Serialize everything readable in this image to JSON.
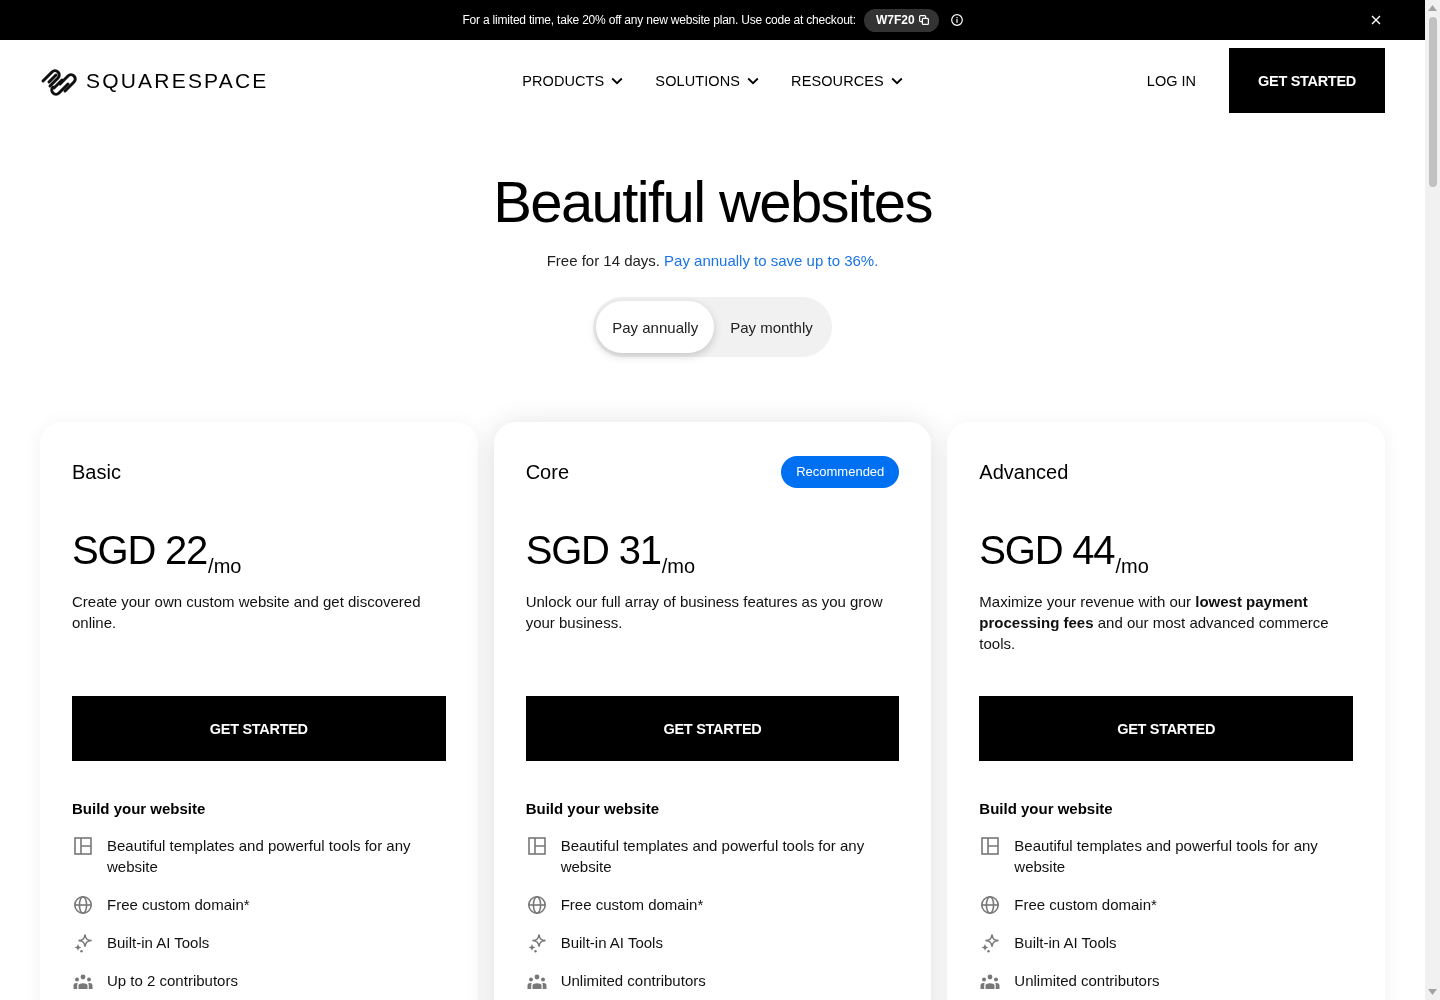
{
  "promo_banner": {
    "text": "For a limited time, take 20% off any new website plan. Use code at checkout:",
    "code": "W7F20"
  },
  "header": {
    "logo": "SQUARESPACE",
    "nav": [
      {
        "label": "PRODUCTS"
      },
      {
        "label": "SOLUTIONS"
      },
      {
        "label": "RESOURCES"
      }
    ],
    "login": "LOG IN",
    "cta": "GET STARTED"
  },
  "hero": {
    "title": "Beautiful websites",
    "subtitle": "Free for 14 days.",
    "link": "Pay annually to save up to 36%."
  },
  "billing_toggle": [
    {
      "label": "Pay annually",
      "selected": true
    },
    {
      "label": "Pay monthly",
      "selected": false
    }
  ],
  "plans": [
    {
      "name": "Basic",
      "price": "SGD 22",
      "period": "/mo",
      "description": "Create your own custom website and get discovered online.",
      "button": "GET STARTED",
      "features_heading": "Build your website",
      "features": [
        {
          "kind": "templates",
          "text": "Beautiful templates and powerful tools for any website"
        },
        {
          "kind": "domain",
          "text": "Free custom domain*"
        },
        {
          "kind": "ai",
          "text": "Built-in AI Tools"
        },
        {
          "kind": "contributors",
          "text": "Up to 2 contributors"
        }
      ]
    },
    {
      "name": "Core",
      "badge": "Recommended",
      "price": "SGD 31",
      "period": "/mo",
      "description": "Unlock our full array of business features as you grow your business.",
      "button": "GET STARTED",
      "features_heading": "Build your website",
      "features": [
        {
          "kind": "templates",
          "text": "Beautiful templates and powerful tools for any website"
        },
        {
          "kind": "domain",
          "text": "Free custom domain*"
        },
        {
          "kind": "ai",
          "text": "Built-in AI Tools"
        },
        {
          "kind": "contributors",
          "text": "Unlimited contributors"
        }
      ]
    },
    {
      "name": "Advanced",
      "price": "SGD 44",
      "period": "/mo",
      "description": "Maximize your revenue with our **lowest payment processing fees** and our most advanced commerce tools.",
      "button": "GET STARTED",
      "features_heading": "Build your website",
      "features": [
        {
          "kind": "templates",
          "text": "Beautiful templates and powerful tools for any website"
        },
        {
          "kind": "domain",
          "text": "Free custom domain*"
        },
        {
          "kind": "ai",
          "text": "Built-in AI Tools"
        },
        {
          "kind": "contributors",
          "text": "Unlimited contributors"
        }
      ]
    }
  ]
}
